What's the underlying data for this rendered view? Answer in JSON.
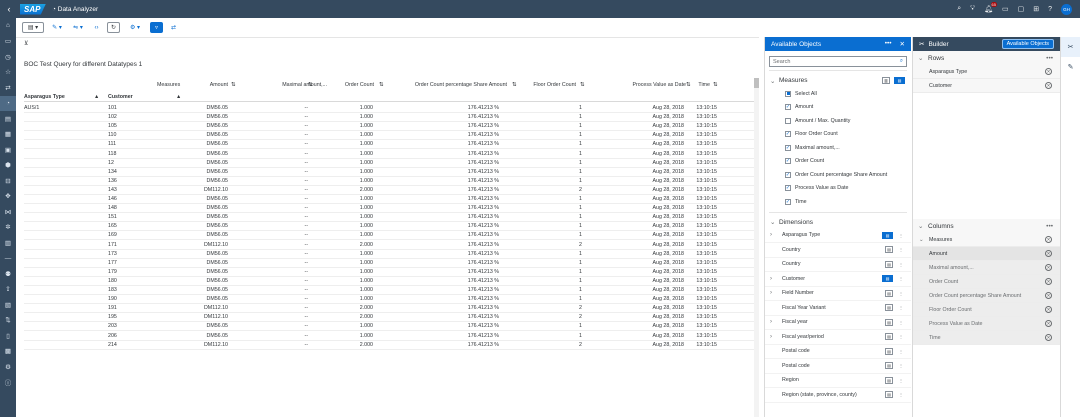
{
  "shell": {
    "logo": "SAP",
    "app_title": "Data Analyzer",
    "notification_count": "65",
    "avatar_initials": "GH"
  },
  "report_title": "BOC Test Query for different Datatypes 1",
  "table": {
    "header_measures": "Measures",
    "row_dim1": "Asparagus Type",
    "row_dim2": "Customer",
    "columns": [
      "Amount",
      "Maximal amount,...",
      "Order Count",
      "Order Count percentage Share Amount",
      "Floor Order Count",
      "Process Value as Date",
      "Time"
    ],
    "rows": [
      {
        "type": "AUS/1",
        "customer": "101",
        "amount": "DM56.05",
        "max": "--",
        "order_count": "1.000",
        "pct": "176.41213 %",
        "floor": "1",
        "date": "Aug 28, 2018",
        "time": "13:10:15"
      },
      {
        "type": "",
        "customer": "102",
        "amount": "DM56.05",
        "max": "--",
        "order_count": "1.000",
        "pct": "176.41213 %",
        "floor": "1",
        "date": "Aug 28, 2018",
        "time": "13:10:15"
      },
      {
        "type": "",
        "customer": "105",
        "amount": "DM56.05",
        "max": "--",
        "order_count": "1.000",
        "pct": "176.41213 %",
        "floor": "1",
        "date": "Aug 28, 2018",
        "time": "13:10:15"
      },
      {
        "type": "",
        "customer": "110",
        "amount": "DM56.05",
        "max": "--",
        "order_count": "1.000",
        "pct": "176.41213 %",
        "floor": "1",
        "date": "Aug 28, 2018",
        "time": "13:10:15"
      },
      {
        "type": "",
        "customer": "111",
        "amount": "DM56.05",
        "max": "--",
        "order_count": "1.000",
        "pct": "176.41213 %",
        "floor": "1",
        "date": "Aug 28, 2018",
        "time": "13:10:15"
      },
      {
        "type": "",
        "customer": "118",
        "amount": "DM56.05",
        "max": "--",
        "order_count": "1.000",
        "pct": "176.41213 %",
        "floor": "1",
        "date": "Aug 28, 2018",
        "time": "13:10:15"
      },
      {
        "type": "",
        "customer": "12",
        "amount": "DM56.05",
        "max": "--",
        "order_count": "1.000",
        "pct": "176.41213 %",
        "floor": "1",
        "date": "Aug 28, 2018",
        "time": "13:10:15"
      },
      {
        "type": "",
        "customer": "134",
        "amount": "DM56.05",
        "max": "--",
        "order_count": "1.000",
        "pct": "176.41213 %",
        "floor": "1",
        "date": "Aug 28, 2018",
        "time": "13:10:15"
      },
      {
        "type": "",
        "customer": "136",
        "amount": "DM56.05",
        "max": "--",
        "order_count": "1.000",
        "pct": "176.41213 %",
        "floor": "1",
        "date": "Aug 28, 2018",
        "time": "13:10:15"
      },
      {
        "type": "",
        "customer": "143",
        "amount": "DM112.10",
        "max": "--",
        "order_count": "2.000",
        "pct": "176.41213 %",
        "floor": "2",
        "date": "Aug 28, 2018",
        "time": "13:10:15"
      },
      {
        "type": "",
        "customer": "146",
        "amount": "DM56.05",
        "max": "--",
        "order_count": "1.000",
        "pct": "176.41213 %",
        "floor": "1",
        "date": "Aug 28, 2018",
        "time": "13:10:15"
      },
      {
        "type": "",
        "customer": "148",
        "amount": "DM56.05",
        "max": "--",
        "order_count": "1.000",
        "pct": "176.41213 %",
        "floor": "1",
        "date": "Aug 28, 2018",
        "time": "13:10:15"
      },
      {
        "type": "",
        "customer": "151",
        "amount": "DM56.05",
        "max": "--",
        "order_count": "1.000",
        "pct": "176.41213 %",
        "floor": "1",
        "date": "Aug 28, 2018",
        "time": "13:10:15"
      },
      {
        "type": "",
        "customer": "165",
        "amount": "DM56.05",
        "max": "--",
        "order_count": "1.000",
        "pct": "176.41213 %",
        "floor": "1",
        "date": "Aug 28, 2018",
        "time": "13:10:15"
      },
      {
        "type": "",
        "customer": "169",
        "amount": "DM56.05",
        "max": "--",
        "order_count": "1.000",
        "pct": "176.41213 %",
        "floor": "1",
        "date": "Aug 28, 2018",
        "time": "13:10:15"
      },
      {
        "type": "",
        "customer": "171",
        "amount": "DM112.10",
        "max": "--",
        "order_count": "2.000",
        "pct": "176.41213 %",
        "floor": "2",
        "date": "Aug 28, 2018",
        "time": "13:10:15"
      },
      {
        "type": "",
        "customer": "173",
        "amount": "DM56.05",
        "max": "--",
        "order_count": "1.000",
        "pct": "176.41213 %",
        "floor": "1",
        "date": "Aug 28, 2018",
        "time": "13:10:15"
      },
      {
        "type": "",
        "customer": "177",
        "amount": "DM56.05",
        "max": "--",
        "order_count": "1.000",
        "pct": "176.41213 %",
        "floor": "1",
        "date": "Aug 28, 2018",
        "time": "13:10:15"
      },
      {
        "type": "",
        "customer": "179",
        "amount": "DM56.05",
        "max": "--",
        "order_count": "1.000",
        "pct": "176.41213 %",
        "floor": "1",
        "date": "Aug 28, 2018",
        "time": "13:10:15"
      },
      {
        "type": "",
        "customer": "180",
        "amount": "DM56.05",
        "max": "--",
        "order_count": "1.000",
        "pct": "176.41213 %",
        "floor": "1",
        "date": "Aug 28, 2018",
        "time": "13:10:15"
      },
      {
        "type": "",
        "customer": "183",
        "amount": "DM56.05",
        "max": "--",
        "order_count": "1.000",
        "pct": "176.41213 %",
        "floor": "1",
        "date": "Aug 28, 2018",
        "time": "13:10:15"
      },
      {
        "type": "",
        "customer": "190",
        "amount": "DM56.05",
        "max": "--",
        "order_count": "1.000",
        "pct": "176.41213 %",
        "floor": "1",
        "date": "Aug 28, 2018",
        "time": "13:10:15"
      },
      {
        "type": "",
        "customer": "191",
        "amount": "DM112.10",
        "max": "--",
        "order_count": "2.000",
        "pct": "176.41213 %",
        "floor": "2",
        "date": "Aug 28, 2018",
        "time": "13:10:15"
      },
      {
        "type": "",
        "customer": "195",
        "amount": "DM112.10",
        "max": "--",
        "order_count": "2.000",
        "pct": "176.41213 %",
        "floor": "2",
        "date": "Aug 28, 2018",
        "time": "13:10:15"
      },
      {
        "type": "",
        "customer": "203",
        "amount": "DM56.05",
        "max": "--",
        "order_count": "1.000",
        "pct": "176.41213 %",
        "floor": "1",
        "date": "Aug 28, 2018",
        "time": "13:10:15"
      },
      {
        "type": "",
        "customer": "206",
        "amount": "DM56.05",
        "max": "--",
        "order_count": "1.000",
        "pct": "176.41213 %",
        "floor": "1",
        "date": "Aug 28, 2018",
        "time": "13:10:15"
      },
      {
        "type": "",
        "customer": "214",
        "amount": "DM112.10",
        "max": "--",
        "order_count": "2.000",
        "pct": "176.41213 %",
        "floor": "2",
        "date": "Aug 28, 2018",
        "time": "13:10:15"
      }
    ]
  },
  "available_objects": {
    "title": "Available Objects",
    "search_placeholder": "Search",
    "measures_label": "Measures",
    "measures": [
      {
        "label": "Select All",
        "state": "partial"
      },
      {
        "label": "Amount",
        "state": "checked"
      },
      {
        "label": "Amount / Max. Quantity",
        "state": "unchecked"
      },
      {
        "label": "Floor Order Count",
        "state": "checked"
      },
      {
        "label": "Maximal amount,...",
        "state": "checked"
      },
      {
        "label": "Order Count",
        "state": "checked"
      },
      {
        "label": "Order Count percentage Share Amount",
        "state": "checked"
      },
      {
        "label": "Process Value as Date",
        "state": "checked"
      },
      {
        "label": "Time",
        "state": "checked"
      }
    ],
    "dimensions_label": "Dimensions",
    "dimensions": [
      {
        "label": "Asparagus Type",
        "expandable": true,
        "in_rows": true
      },
      {
        "label": "Country",
        "expandable": false,
        "in_rows": false
      },
      {
        "label": "Country",
        "expandable": false,
        "in_rows": false
      },
      {
        "label": "Customer",
        "expandable": true,
        "in_rows": true
      },
      {
        "label": "Field Number",
        "expandable": true,
        "in_rows": false
      },
      {
        "label": "Fiscal Year Variant",
        "expandable": false,
        "in_rows": false
      },
      {
        "label": "Fiscal year",
        "expandable": true,
        "in_rows": false
      },
      {
        "label": "Fiscal year/period",
        "expandable": true,
        "in_rows": false
      },
      {
        "label": "Postal code",
        "expandable": false,
        "in_rows": false
      },
      {
        "label": "Postal code",
        "expandable": false,
        "in_rows": false
      },
      {
        "label": "Region",
        "expandable": false,
        "in_rows": false
      },
      {
        "label": "Region (state, province, county)",
        "expandable": false,
        "in_rows": false
      }
    ]
  },
  "builder": {
    "title": "Builder",
    "available_objects_button": "Available Objects",
    "rows_label": "Rows",
    "rows": [
      "Asparagus Type",
      "Customer"
    ],
    "columns_label": "Columns",
    "columns_header": "Measures",
    "columns": [
      "Amount",
      "Maximal amount,...",
      "Order Count",
      "Order Count percentage Share Amount",
      "Floor Order Count",
      "Process Value as Date",
      "Time"
    ]
  },
  "colors": {
    "shell": "#354a5f",
    "accent": "#0a6ed1"
  }
}
